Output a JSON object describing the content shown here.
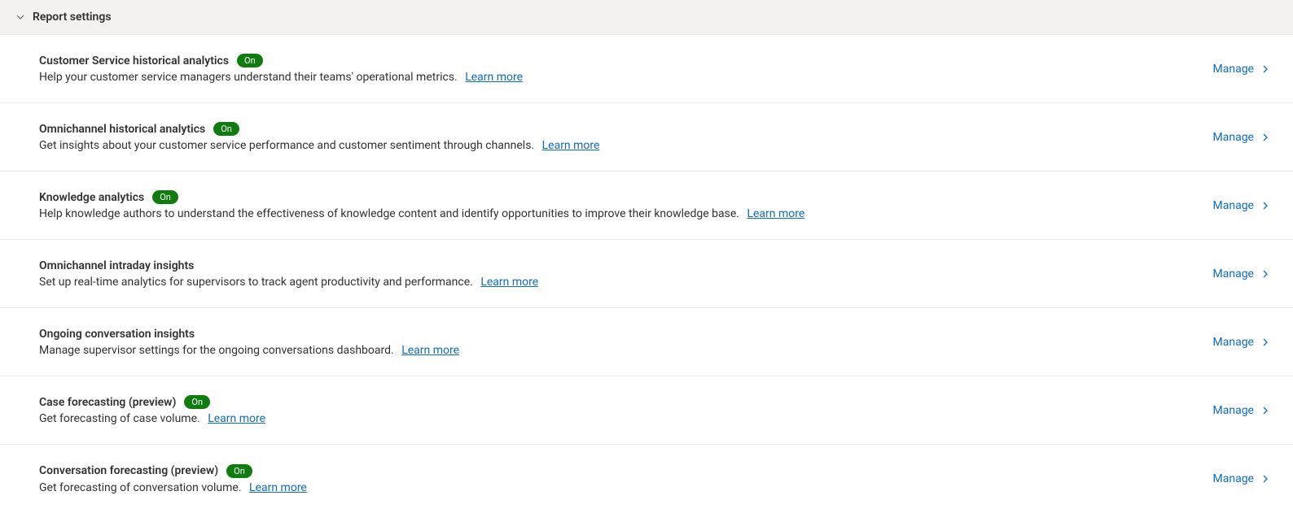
{
  "section": {
    "title": "Report settings"
  },
  "badge": {
    "on_label": "On"
  },
  "manage_label": "Manage",
  "learn_more_label": "Learn more",
  "items": [
    {
      "title": "Customer Service historical analytics",
      "badge": "on",
      "desc": "Help your customer service managers understand their teams' operational metrics."
    },
    {
      "title": "Omnichannel historical analytics",
      "badge": "on",
      "desc": "Get insights about your customer service performance and customer sentiment through channels."
    },
    {
      "title": "Knowledge analytics",
      "badge": "on",
      "desc": "Help knowledge authors to understand the effectiveness of knowledge content and identify opportunities to improve their knowledge base."
    },
    {
      "title": "Omnichannel intraday insights",
      "badge": null,
      "desc": "Set up real-time analytics for supervisors to track agent productivity and performance."
    },
    {
      "title": "Ongoing conversation insights",
      "badge": null,
      "desc": "Manage supervisor settings for the ongoing conversations dashboard."
    },
    {
      "title": "Case forecasting (preview)",
      "badge": "on",
      "desc": "Get forecasting of case volume."
    },
    {
      "title": "Conversation forecasting (preview)",
      "badge": "on",
      "desc": "Get forecasting of conversation volume."
    }
  ]
}
